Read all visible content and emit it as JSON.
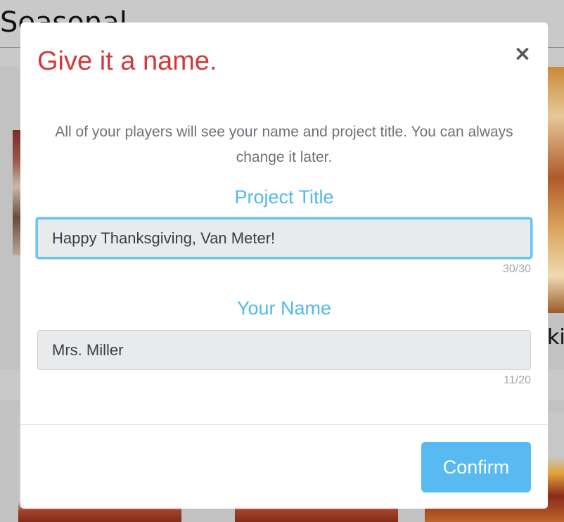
{
  "background": {
    "title": "Seasonal",
    "right_caption": "ki"
  },
  "modal": {
    "title": "Give it a name.",
    "close_label": "×",
    "description": "All of your players will see your name and project title. You can always change it later.",
    "project_title": {
      "label": "Project Title",
      "value": "Happy Thanksgiving, Van Meter!",
      "counter": "30/30"
    },
    "your_name": {
      "label": "Your Name",
      "value": "Mrs. Miller",
      "counter": "11/20"
    },
    "confirm_label": "Confirm"
  },
  "colors": {
    "title_red": "#d23a3a",
    "label_blue": "#54b8ec",
    "confirm_blue": "#58baf0",
    "overlay_gray": "#c9c9ca"
  },
  "icons": {
    "close": "close-icon"
  }
}
